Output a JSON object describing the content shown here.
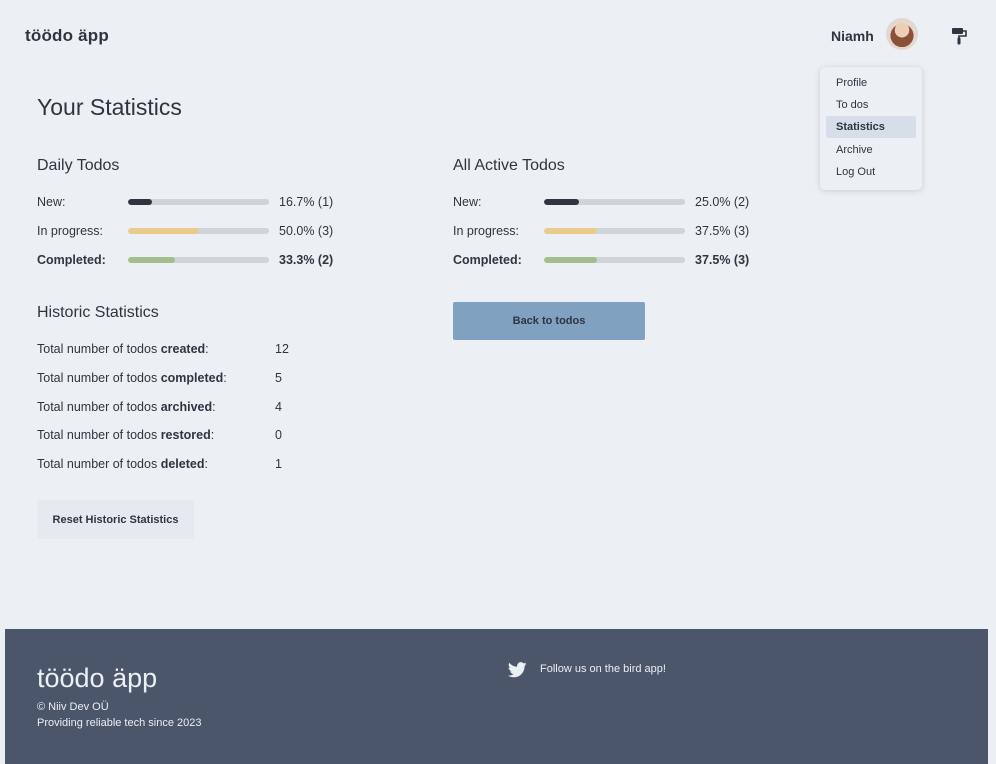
{
  "app": {
    "brand": "töödo äpp"
  },
  "header": {
    "username": "Niamh"
  },
  "menu": {
    "items": [
      {
        "label": "Profile"
      },
      {
        "label": "To dos"
      },
      {
        "label": "Statistics",
        "active": true
      },
      {
        "label": "Archive"
      },
      {
        "label": "Log Out"
      }
    ]
  },
  "page": {
    "title": "Your Statistics"
  },
  "daily": {
    "title": "Daily Todos",
    "rows": [
      {
        "label": "New:",
        "value": "16.7% (1)",
        "percent": 16.7
      },
      {
        "label": "In progress:",
        "value": "50.0% (3)",
        "percent": 50.0
      },
      {
        "label": "Completed:",
        "value": "33.3% (2)",
        "percent": 33.3
      }
    ]
  },
  "active": {
    "title": "All Active Todos",
    "rows": [
      {
        "label": "New:",
        "value": "25.0% (2)",
        "percent": 25.0
      },
      {
        "label": "In progress:",
        "value": "37.5% (3)",
        "percent": 37.5
      },
      {
        "label": "Completed:",
        "value": "37.5% (3)",
        "percent": 37.5
      }
    ]
  },
  "history": {
    "title": "Historic Statistics",
    "prefix": "Total number of todos ",
    "rows": [
      {
        "keyword": "created",
        "value": "12"
      },
      {
        "keyword": "completed",
        "value": "5"
      },
      {
        "keyword": "archived",
        "value": "4"
      },
      {
        "keyword": "restored",
        "value": "0"
      },
      {
        "keyword": "deleted",
        "value": "1"
      }
    ],
    "reset_label": "Reset Historic Statistics"
  },
  "actions": {
    "back_label": "Back to todos"
  },
  "footer": {
    "brand": "töödo äpp",
    "copyright": "© Niiv Dev OÜ",
    "tagline": "Providing reliable tech since 2023",
    "twitter_text": "Follow us on the bird app!"
  },
  "colors": {
    "background": "#eceff4",
    "new": "#2e3440",
    "in_progress": "#ebcb8b",
    "completed": "#a3be8c",
    "accent_button": "#81a1c1",
    "footer": "#4c566a"
  },
  "icons": {
    "theme": "paint-roller-icon",
    "twitter": "twitter-bird-icon"
  }
}
